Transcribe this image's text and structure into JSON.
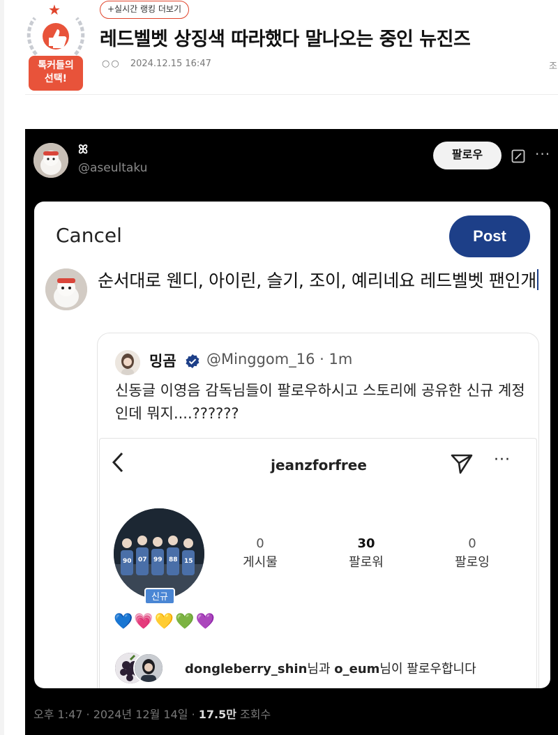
{
  "header": {
    "badge_label_line1": "톡커들의",
    "badge_label_line2": "선택!",
    "ranking_link": "+실시간 랭킹 더보기",
    "headline": "레드벨벳 상징색 따라했다 말나오는 중인 뉴진즈",
    "author_dots": "○○",
    "timestamp": "2024.12.15 16:47",
    "views_label": "조"
  },
  "tweet": {
    "display_name": "ꕤ",
    "handle": "@aseultaku",
    "follow_label": "팔로우",
    "more_icon": "more-icon",
    "footer_time": "오후 1:47 · 2024년 12월 14일 · ",
    "footer_views": "17.5만",
    "footer_views_label": " 조회수",
    "composer": {
      "cancel_label": "Cancel",
      "post_label": "Post",
      "text": "순서대로 웬디, 아이린, 슬기, 조이, 예리네요 레드벨벳 팬인개"
    },
    "quote": {
      "name": "밍곰",
      "handle": "@Minggom_16 · 1m",
      "text": "신동글 이영음 감독님들이 팔로우하시고 스토리에 공유한 신규 계정인데 뭐지....??????",
      "instagram": {
        "username": "jeanzforfree",
        "new_badge": "신규",
        "stats": [
          {
            "value": "0",
            "label": "게시물"
          },
          {
            "value": "30",
            "label": "팔로워"
          },
          {
            "value": "0",
            "label": "팔로잉"
          }
        ],
        "hearts": "💙💗💛💚💜",
        "followed_by_user1": "dongleberry_shin",
        "followed_by_mid": "님과 ",
        "followed_by_user2": "o_eum",
        "followed_by_end": "님이 팔로우합니다"
      }
    }
  },
  "colors": {
    "accent_red": "#e0442b",
    "post_button": "#1d3f88",
    "tweet_bg": "#000000",
    "verified_blue": "#1d3f88"
  }
}
